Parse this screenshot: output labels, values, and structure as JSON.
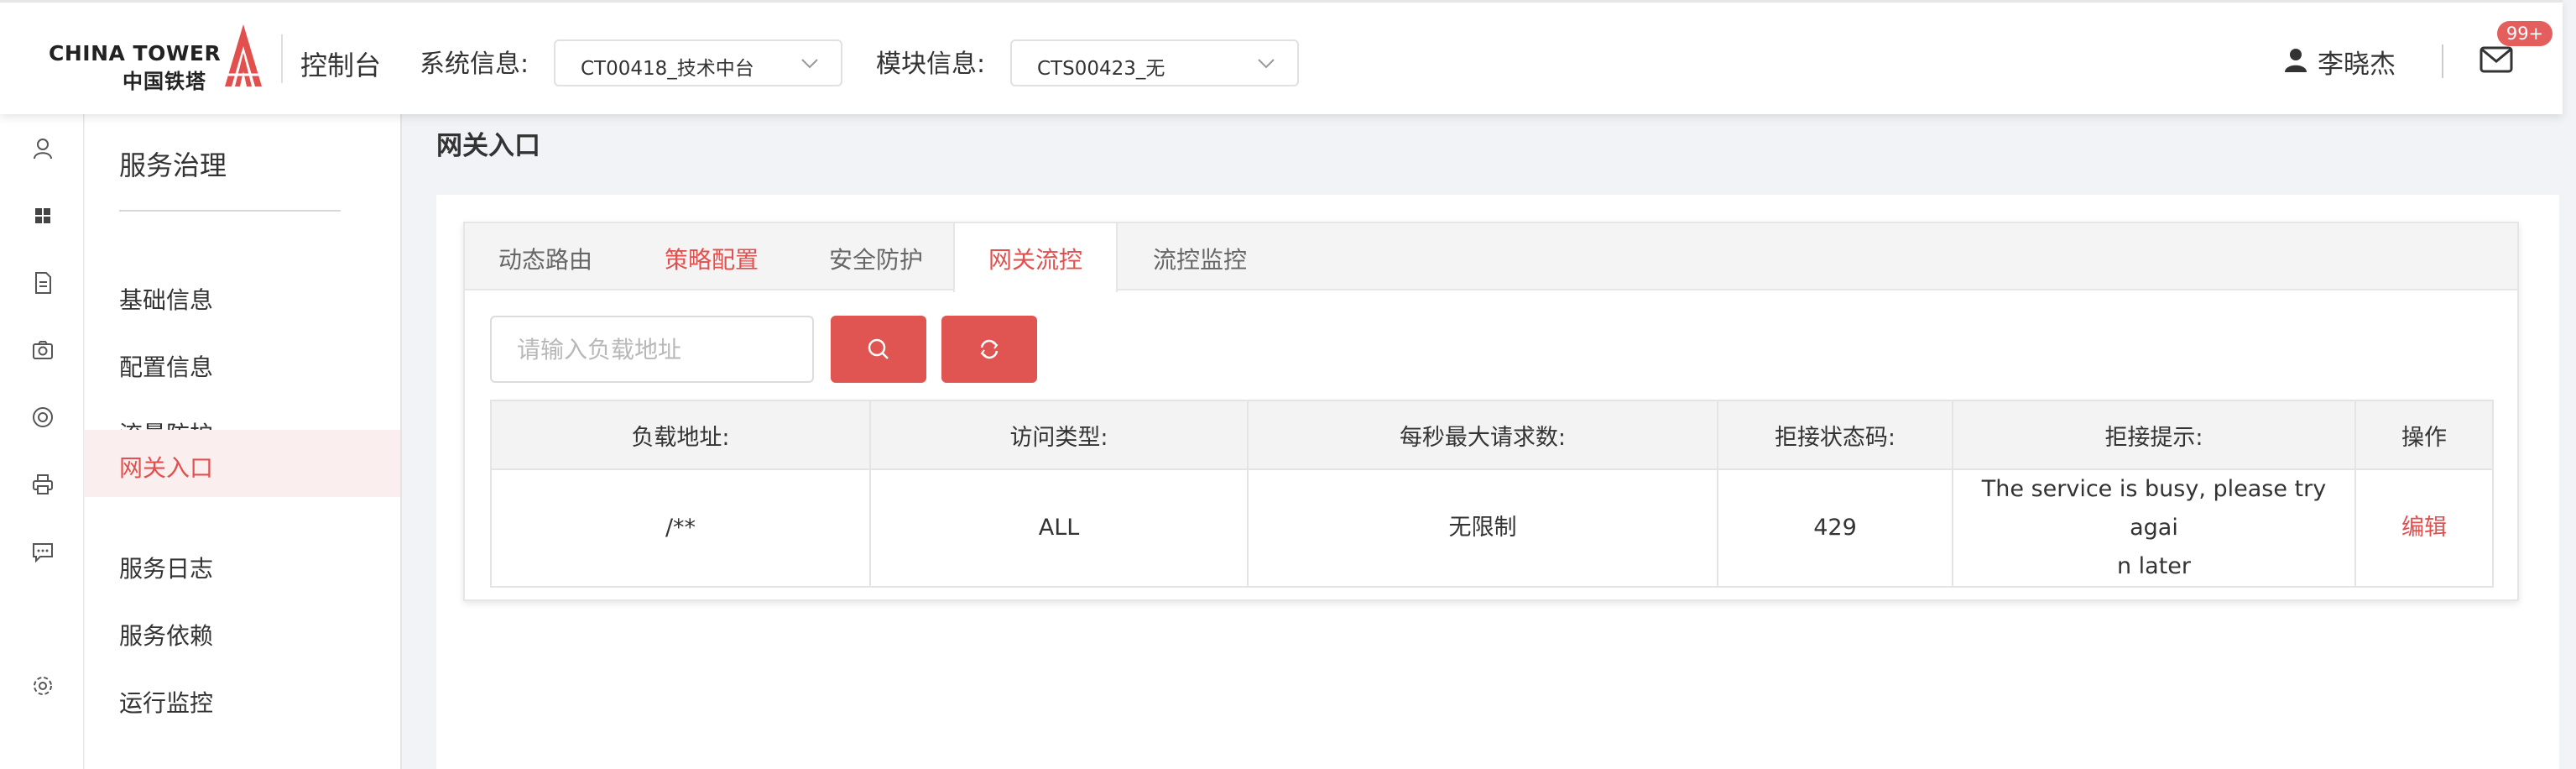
{
  "header": {
    "logo_en": "CHINA TOWER",
    "logo_cn": "中国铁塔",
    "console_label": "控制台",
    "system_label": "系统信息:",
    "system_value": "CT00418_技术中台",
    "module_label": "模块信息:",
    "module_value": "CTS00423_无",
    "user_name": "李晓杰",
    "mail_badge": "99+"
  },
  "colors": {
    "accent": "#e05552",
    "active_bg": "#fbeeee"
  },
  "iconbar": [
    "user-icon",
    "apps-icon",
    "document-icon",
    "camera-icon",
    "target-icon",
    "printer-icon",
    "chat-icon",
    "settings-icon"
  ],
  "sidebar": {
    "title": "服务治理",
    "items": [
      {
        "label": "基础信息"
      },
      {
        "label": "配置信息"
      },
      {
        "label": "流量防护"
      },
      {
        "label": "网关入口",
        "active": true
      },
      {
        "label": "服务日志"
      },
      {
        "label": "服务依赖"
      },
      {
        "label": "运行监控"
      }
    ]
  },
  "page": {
    "title": "网关入口"
  },
  "tabs": [
    {
      "label": "动态路由"
    },
    {
      "label": "策略配置"
    },
    {
      "label": "安全防护"
    },
    {
      "label": "网关流控",
      "active": true
    },
    {
      "label": "流控监控"
    }
  ],
  "search": {
    "placeholder": "请输入负载地址"
  },
  "table": {
    "columns": [
      "负载地址:",
      "访问类型:",
      "每秒最大请求数:",
      "拒接状态码:",
      "拒接提示:",
      "操作"
    ],
    "rows": [
      {
        "path": "/**",
        "type": "ALL",
        "max_rps": "无限制",
        "status_code": "429",
        "hint_line1": "The service is busy, please try agai",
        "hint_line2": "n later",
        "action": "编辑"
      }
    ]
  }
}
